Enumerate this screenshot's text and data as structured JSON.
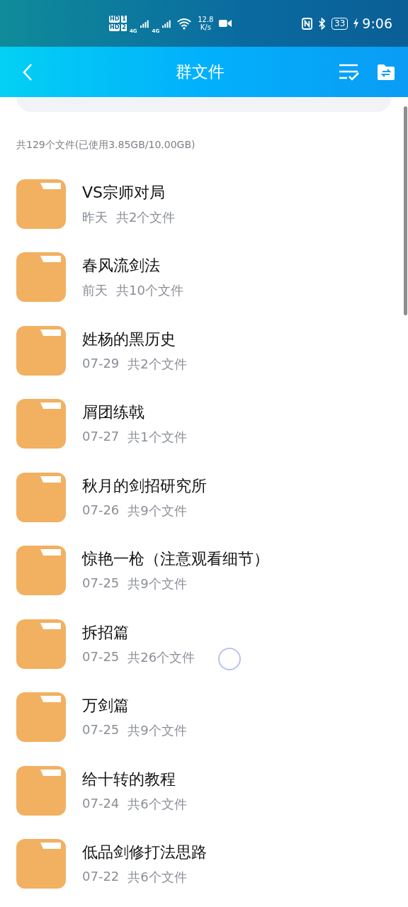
{
  "status_bar": {
    "sim_1": "HD",
    "sim_1_slot": "1",
    "sim_2": "HD",
    "sim_2_slot": "2",
    "network_1": "4G",
    "network_2": "4G",
    "speed": "12.8",
    "speed_unit": "K/s",
    "battery": "33",
    "time": "9:06"
  },
  "header": {
    "title": "群文件"
  },
  "summary": "共129个文件(已使用3.85GB/10.00GB)",
  "folders": [
    {
      "name": "VS宗师对局",
      "date": "昨天",
      "count": "共2个文件"
    },
    {
      "name": "春风流剑法",
      "date": "前天",
      "count": "共10个文件"
    },
    {
      "name": "姓杨的黑历史",
      "date": "07-29",
      "count": "共2个文件"
    },
    {
      "name": "屑团练戟",
      "date": "07-27",
      "count": "共1个文件"
    },
    {
      "name": "秋月的剑招研究所",
      "date": "07-26",
      "count": "共9个文件"
    },
    {
      "name": "惊艳一枪（注意观看细节）",
      "date": "07-25",
      "count": "共9个文件"
    },
    {
      "name": "拆招篇",
      "date": "07-25",
      "count": "共26个文件"
    },
    {
      "name": "万剑篇",
      "date": "07-25",
      "count": "共9个文件"
    },
    {
      "name": "给十转的教程",
      "date": "07-24",
      "count": "共6个文件"
    },
    {
      "name": "低品剑修打法思路",
      "date": "07-22",
      "count": "共6个文件"
    }
  ]
}
